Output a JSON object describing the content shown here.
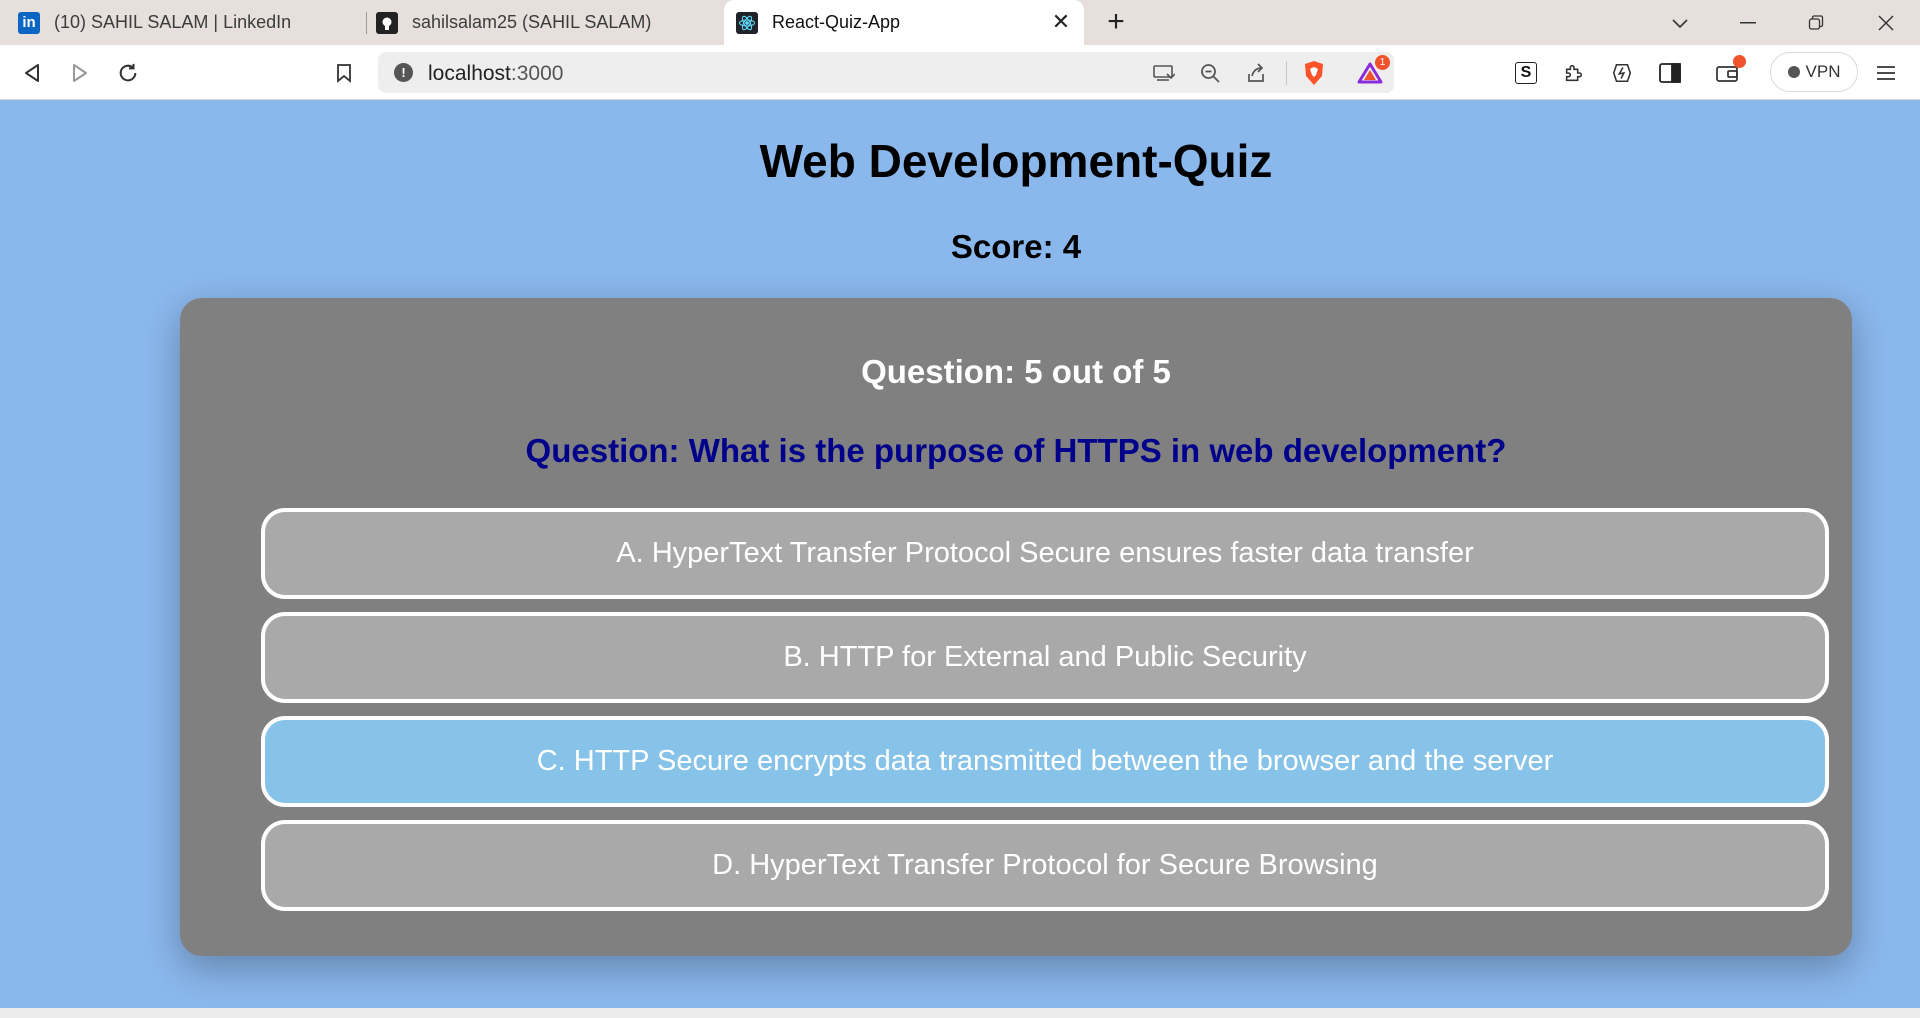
{
  "browser": {
    "tabs": [
      {
        "label": "(10) SAHIL SALAM | LinkedIn",
        "icon": "linkedin-icon"
      },
      {
        "label": "sahilsalam25 (SAHIL SALAM)",
        "icon": "github-icon"
      },
      {
        "label": "React-Quiz-App",
        "icon": "react-icon",
        "active": true
      }
    ],
    "address": {
      "host": "localhost",
      "port": ":3000"
    },
    "shield_badge": "1",
    "vpn_label": "VPN"
  },
  "page": {
    "title": "Web Development-Quiz",
    "score": "Score: 4"
  },
  "quiz": {
    "counter": "Question: 5 out of 5",
    "question": "Question: What is the purpose of HTTPS in web development?",
    "options": [
      {
        "label": "A. HyperText Transfer Protocol Secure ensures faster data transfer",
        "selected": false
      },
      {
        "label": "B. HTTP for External and Public Security",
        "selected": false
      },
      {
        "label": "C. HTTP Secure encrypts data transmitted between the browser and the server",
        "selected": true
      },
      {
        "label": "D. HyperText Transfer Protocol for Secure Browsing",
        "selected": false
      }
    ]
  },
  "colors": {
    "page_background": "#8ab7ec",
    "card_background": "#808080",
    "option_background": "#a9a9a9",
    "option_selected": "#87c3e9",
    "question_text": "#00008b"
  }
}
